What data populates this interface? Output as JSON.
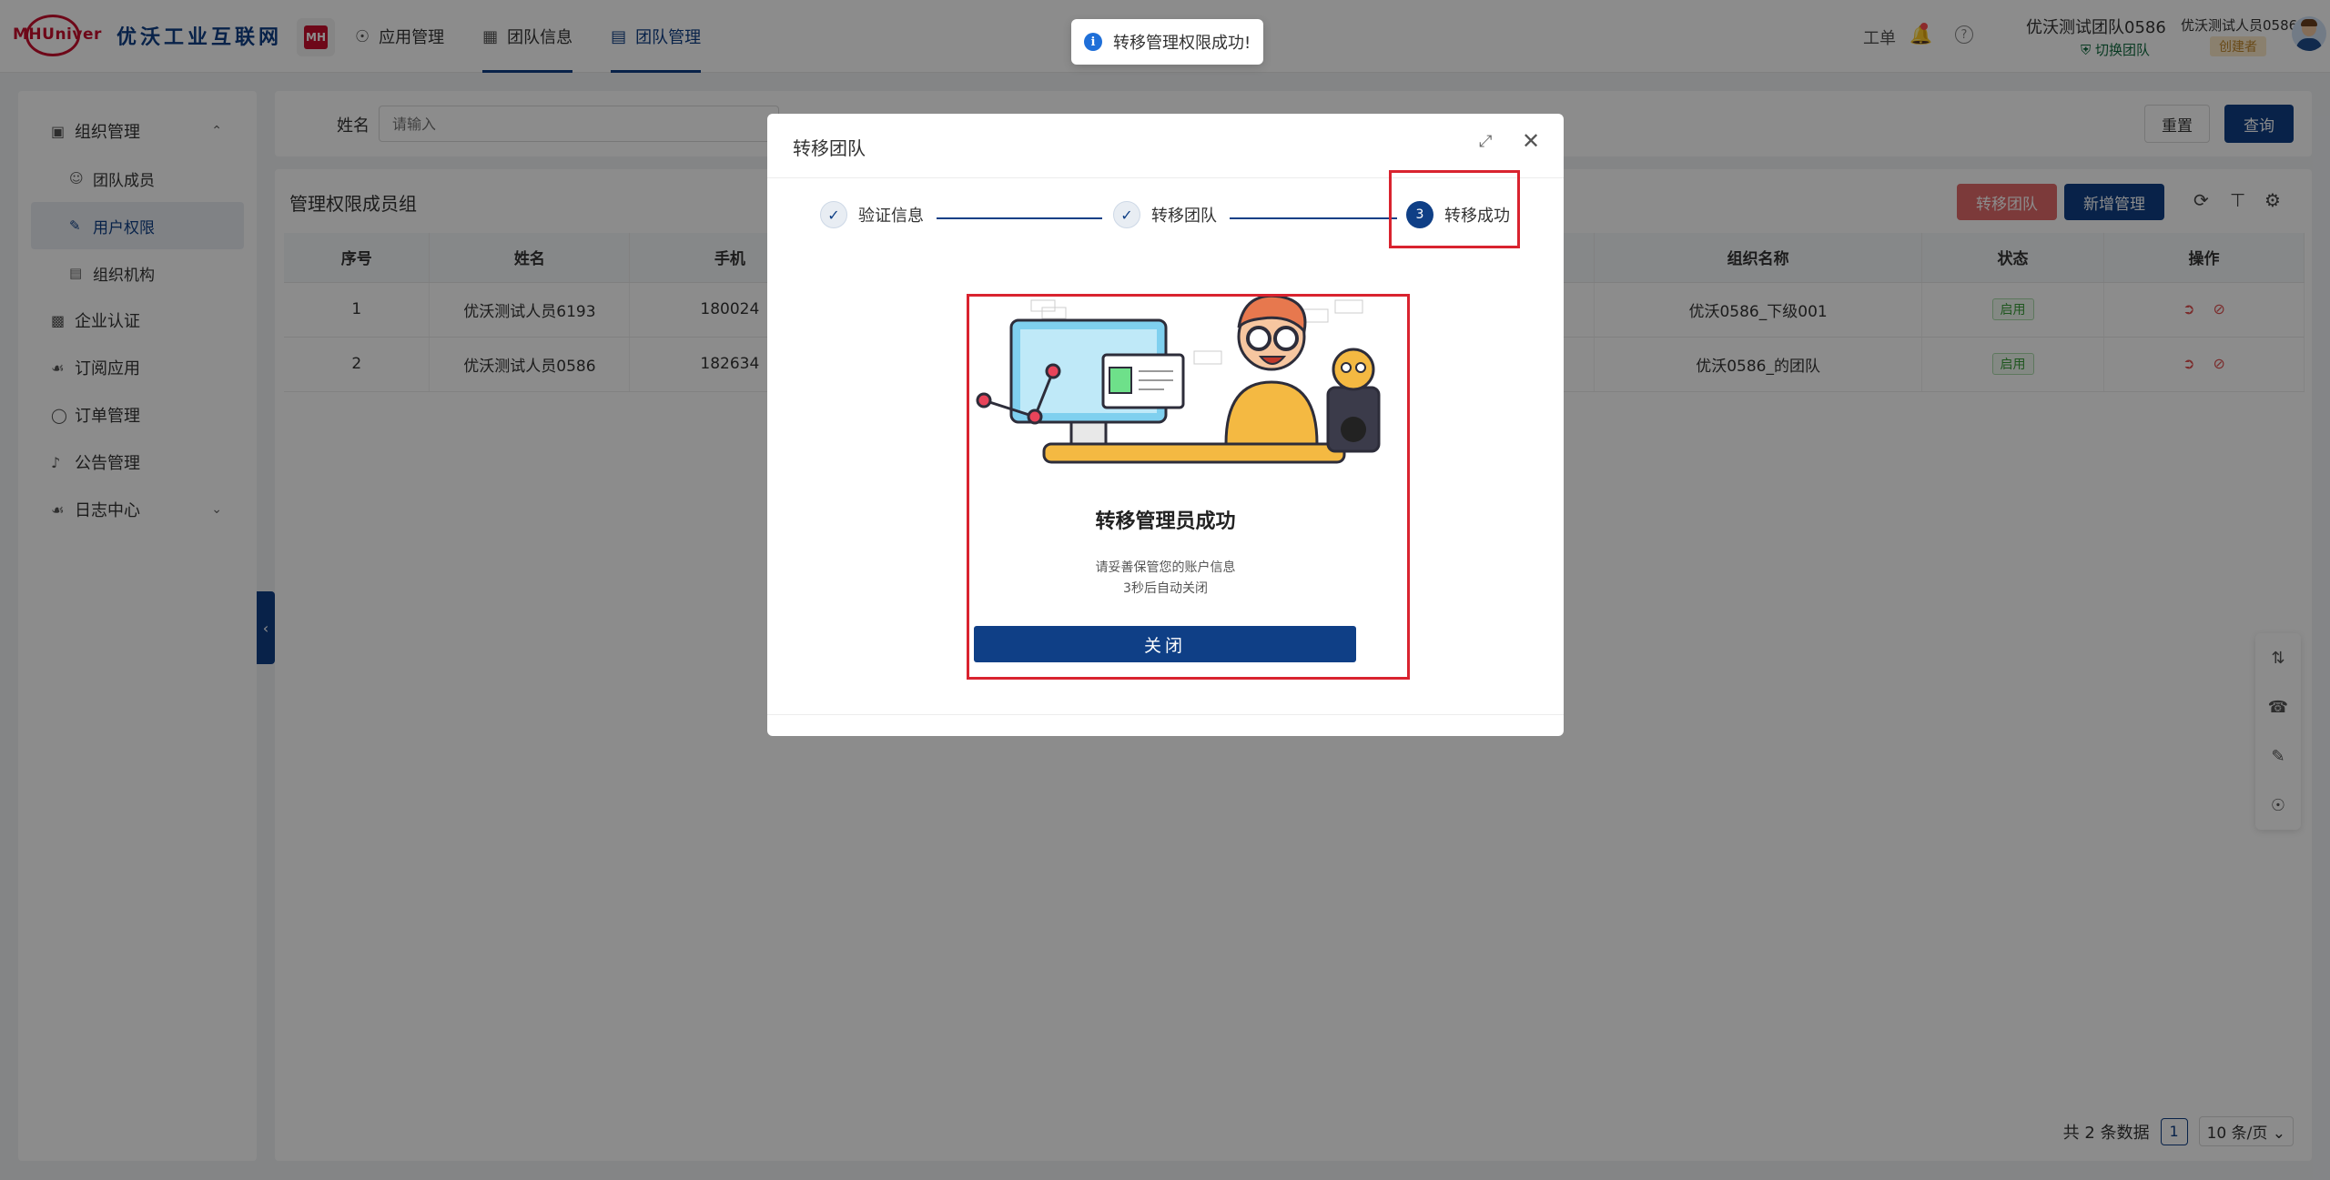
{
  "header": {
    "logo_text": "MHUniver",
    "brand_name": "优沃工业互联网",
    "mh_badge": "MH",
    "nav": [
      {
        "label": "应用管理",
        "icon": "apps-icon"
      },
      {
        "label": "团队信息",
        "icon": "team-info-icon"
      },
      {
        "label": "团队管理",
        "icon": "team-manage-icon"
      }
    ],
    "work_order": "工单",
    "team_name": "优沃测试团队0586",
    "switch_team": "切换团队",
    "user_name": "优沃测试人员0586",
    "role": "创建者"
  },
  "sidebar": {
    "groups": [
      {
        "label": "组织管理",
        "icon": "org-icon",
        "expanded": true
      },
      {
        "label": "企业认证",
        "icon": "enterprise-icon"
      },
      {
        "label": "订阅应用",
        "icon": "subscribe-icon"
      },
      {
        "label": "订单管理",
        "icon": "order-icon"
      },
      {
        "label": "公告管理",
        "icon": "notice-icon"
      },
      {
        "label": "日志中心",
        "icon": "log-icon",
        "expanded": false
      }
    ],
    "sub_items": [
      {
        "label": "团队成员",
        "icon": "member-icon"
      },
      {
        "label": "用户权限",
        "icon": "permission-icon",
        "active": true
      },
      {
        "label": "组织机构",
        "icon": "structure-icon"
      }
    ]
  },
  "search": {
    "label": "姓名",
    "placeholder": "请输入",
    "reset": "重置",
    "query": "查询"
  },
  "main": {
    "section_title": "管理权限成员组",
    "btn_transfer": "转移团队",
    "btn_add": "新增管理",
    "columns": [
      "序号",
      "姓名",
      "手机",
      "组织名称",
      "状态",
      "操作"
    ],
    "rows": [
      {
        "index": "1",
        "name": "优沃测试人员6193",
        "phone": "180024",
        "org": "优沃0586_下级001",
        "status": "启用"
      },
      {
        "index": "2",
        "name": "优沃测试人员0586",
        "phone": "182634",
        "org": "优沃0586_的团队",
        "status": "启用"
      }
    ],
    "pager": {
      "total": "共 2 条数据",
      "page": "1",
      "size": "10 条/页"
    }
  },
  "modal": {
    "title": "转移团队",
    "steps": [
      {
        "label": "验证信息",
        "state": "done"
      },
      {
        "label": "转移团队",
        "state": "done"
      },
      {
        "label": "转移成功",
        "state": "current",
        "number": "3"
      }
    ],
    "result_title": "转移管理员成功",
    "result_desc1": "请妥善保管您的账户信息",
    "result_desc2": "3秒后自动关闭",
    "close_button": "关闭"
  },
  "toast": {
    "message": "转移管理权限成功!"
  },
  "colors": {
    "primary": "#0f3f86",
    "brand_red": "#c8102e",
    "danger_soft": "#e26a6a",
    "highlight_box": "#d9232f"
  }
}
